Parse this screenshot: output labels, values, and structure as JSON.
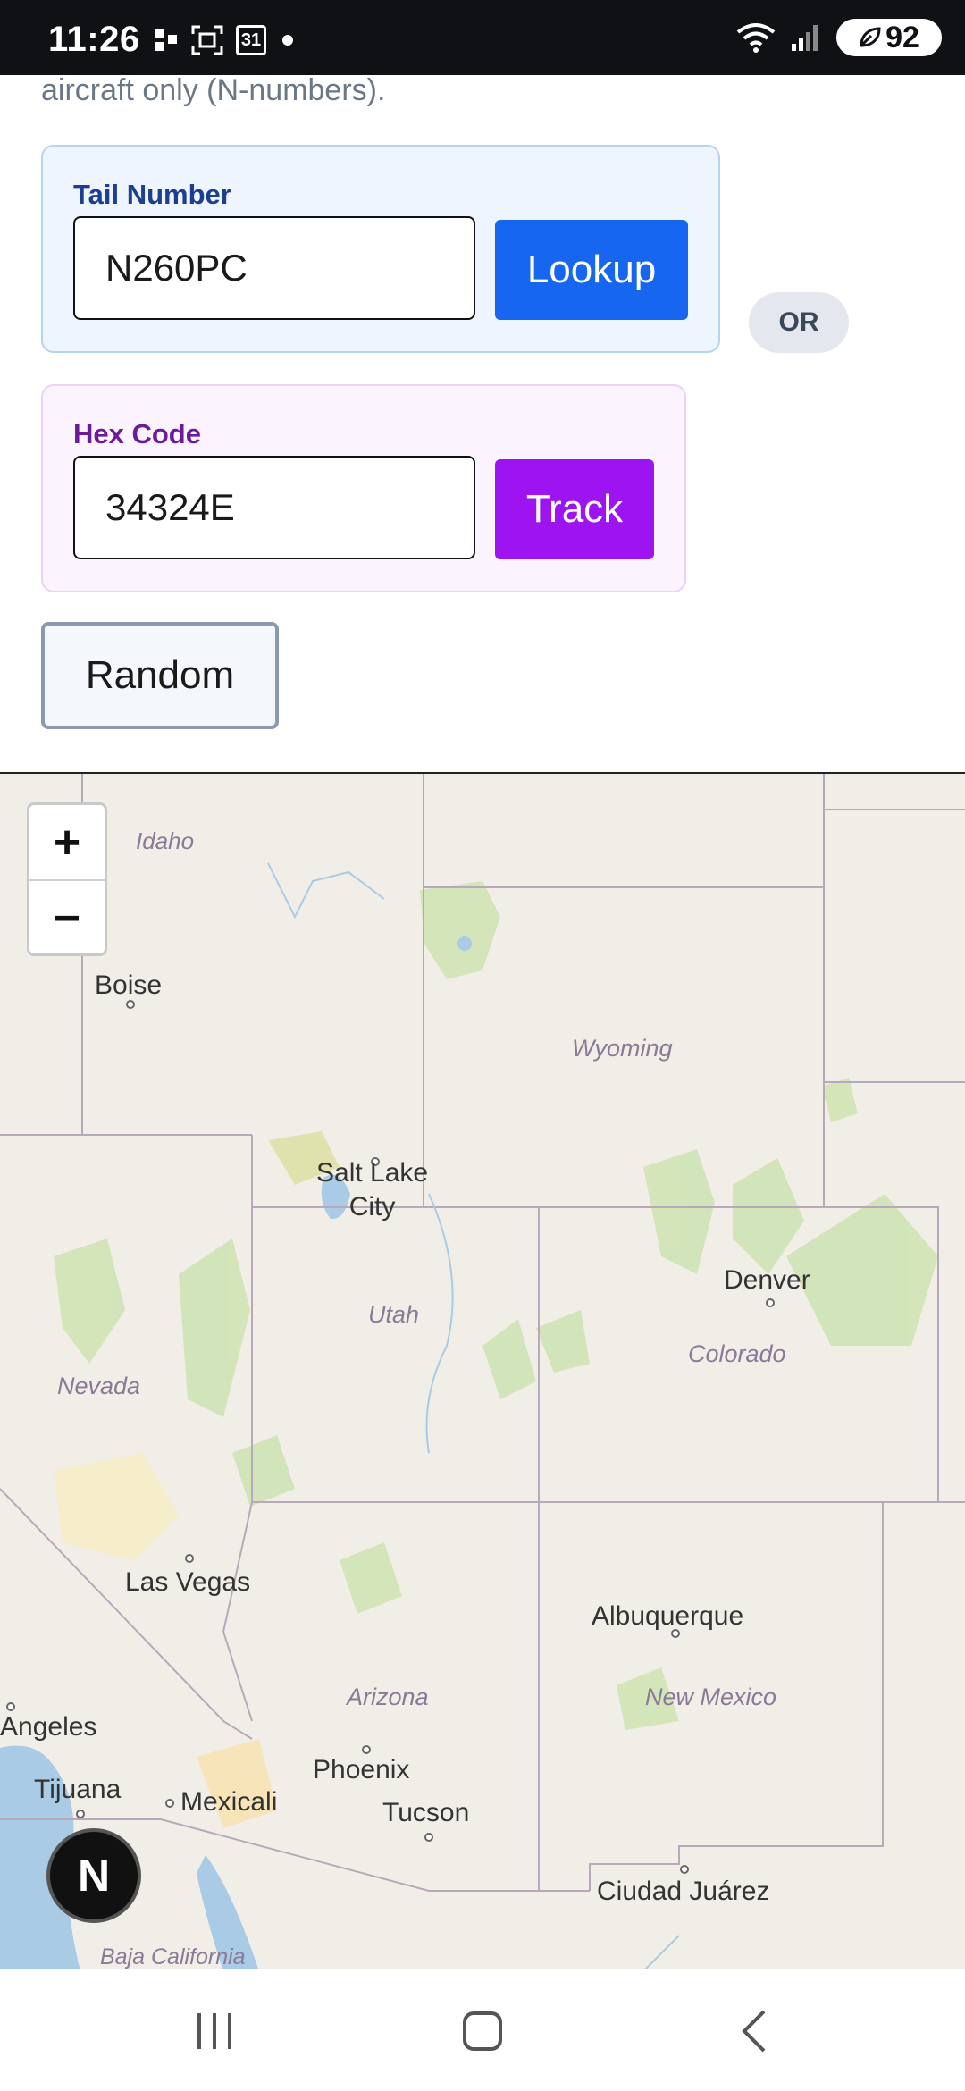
{
  "status_bar": {
    "time": "11:26",
    "calendar_day": "31",
    "battery_level": "92"
  },
  "form": {
    "intro_text": "aircraft only (N-numbers).",
    "tail": {
      "label": "Tail Number",
      "value": "N260PC",
      "button": "Lookup"
    },
    "or_label": "OR",
    "hex": {
      "label": "Hex Code",
      "value": "34324E",
      "button": "Track"
    },
    "random_button": "Random"
  },
  "map": {
    "zoom_in": "+",
    "zoom_out": "−",
    "labels": {
      "idaho": "Idaho",
      "boise": "Boise",
      "wyoming": "Wyoming",
      "salt_lake_1": "Salt Lake",
      "salt_lake_2": "City",
      "utah": "Utah",
      "denver": "Denver",
      "colorado": "Colorado",
      "nevada": "Nevada",
      "las_vegas": "Las Vegas",
      "albuquerque": "Albuquerque",
      "arizona": "Arizona",
      "new_mexico": "New Mexico",
      "los_angeles": "Angeles",
      "phoenix": "Phoenix",
      "tijuana": "Tijuana",
      "mexicali": "Mexicali",
      "tucson": "Tucson",
      "ciudad_juarez": "Ciudad Juárez",
      "baja_california": "Baja California"
    },
    "badge": "N"
  },
  "colors": {
    "lookup": "#1766f0",
    "track": "#9d14f0",
    "map_land": "#f1eee8",
    "water": "#a9cbe6",
    "forest": "#c8dfae"
  }
}
